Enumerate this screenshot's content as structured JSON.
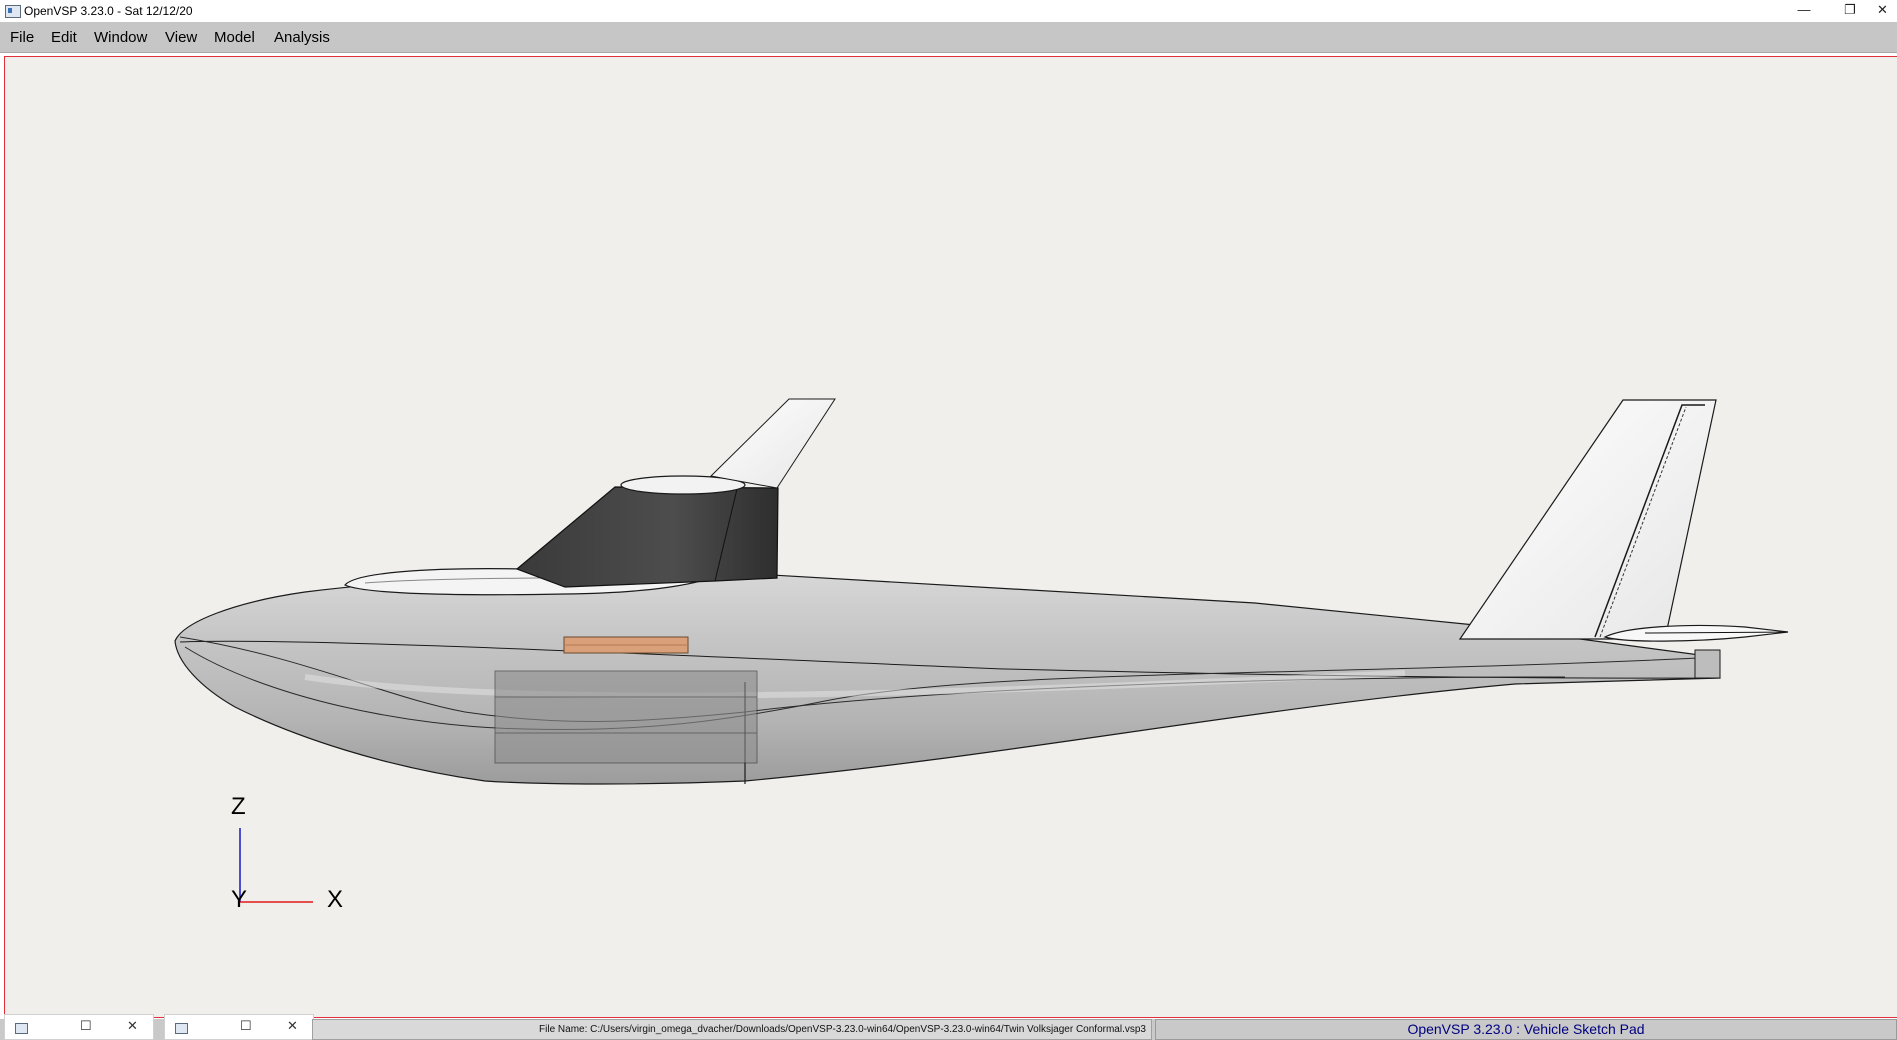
{
  "window": {
    "title": "OpenVSP 3.23.0 - Sat 12/12/20",
    "minimize": "—",
    "restore": "❐",
    "close": "✕"
  },
  "menu": {
    "items": [
      "File",
      "Edit",
      "Window",
      "View",
      "Model",
      "Analysis"
    ]
  },
  "axes": {
    "z": "Z",
    "y": "Y",
    "x": "X"
  },
  "status": {
    "file_name": "File Name: C:/Users/virgin_omega_dvacher/Downloads/OpenVSP-3.23.0-win64/OpenVSP-3.23.0-win64/Twin Volksjager Conformal.vsp3",
    "app_tag": "OpenVSP 3.23.0 : Vehicle Sketch Pad"
  },
  "minimized_windows": [
    {
      "restore": "☐",
      "close": "✕"
    },
    {
      "restore": "☐",
      "close": "✕"
    }
  ],
  "colors": {
    "viewport_bg": "#f0efec",
    "border_red": "#e0303a",
    "menubar": "#c6c6c6",
    "status_blue": "#000080"
  }
}
